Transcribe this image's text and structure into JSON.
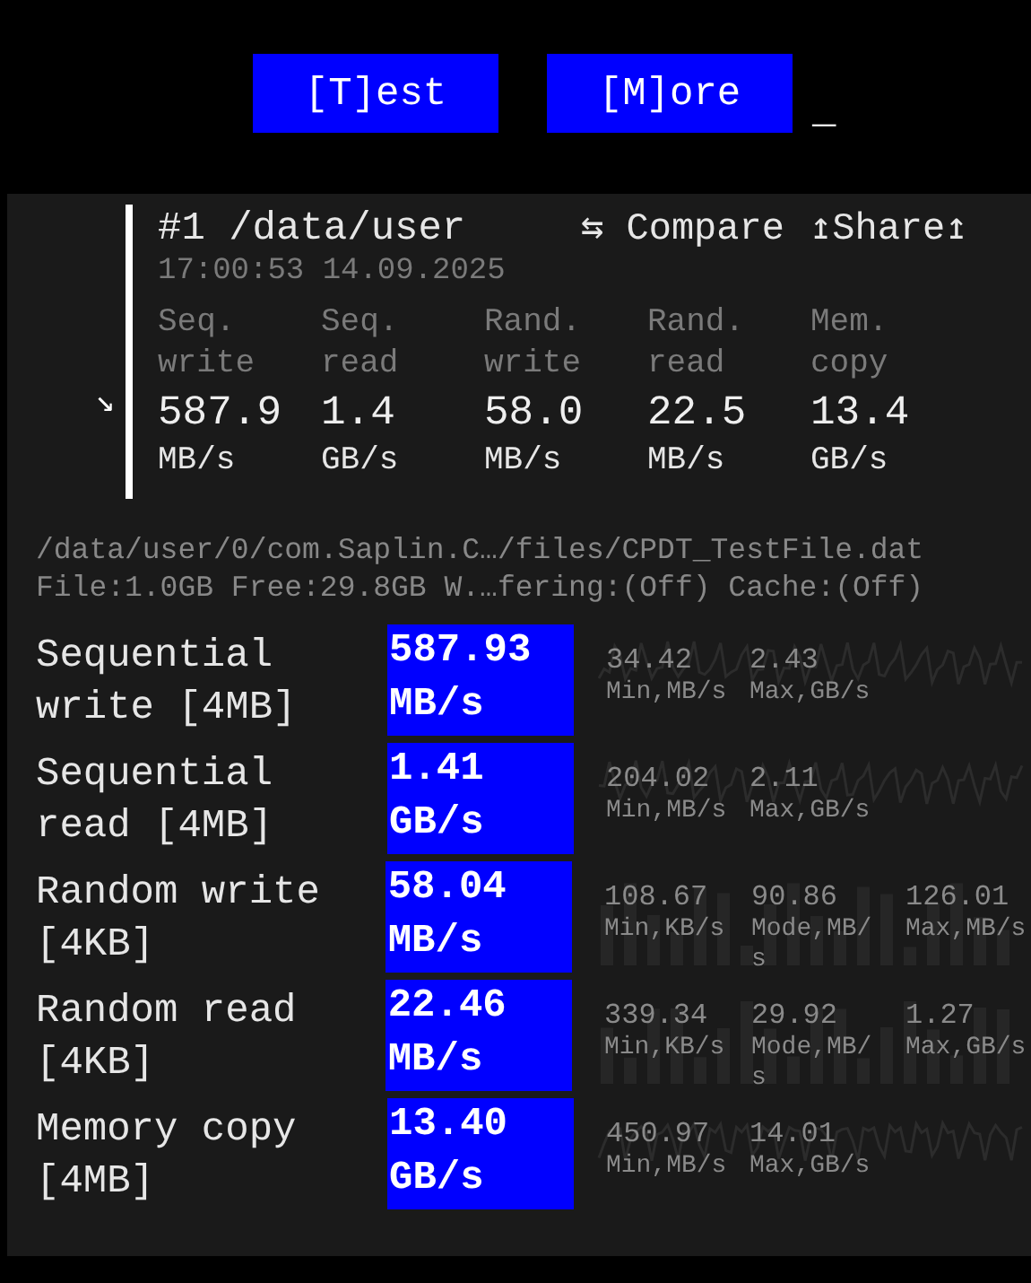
{
  "top_buttons": [
    "[T]est",
    "[M]ore"
  ],
  "cursor": "_",
  "result": {
    "expand_arrow": "↘",
    "title": "#1 /data/user",
    "compare": "⇆ Compare",
    "share": "↥Share↥",
    "timestamp": "17:00:53 14.09.2025",
    "summary": [
      {
        "label": "Seq. write",
        "value": "587.9",
        "unit": "MB/s"
      },
      {
        "label": "Seq. read",
        "value": "1.4",
        "unit": "GB/s"
      },
      {
        "label": "Rand. write",
        "value": "58.0",
        "unit": "MB/s"
      },
      {
        "label": "Rand. read",
        "value": "22.5",
        "unit": "MB/s"
      },
      {
        "label": "Mem. copy",
        "value": "13.4",
        "unit": "GB/s"
      }
    ]
  },
  "file_path": "/data/user/0/com.Saplin.C…/files/CPDT_TestFile.dat",
  "file_info": "File:1.0GB Free:29.8GB W.…fering:(Off) Cache:(Off)",
  "tests": [
    {
      "name": "Sequential write [4MB]",
      "value": "587.93",
      "unit": "MB/s",
      "kind": "line",
      "stats": [
        {
          "value": "34.42",
          "label": "Min,MB/s"
        },
        {
          "value": "2.43",
          "label": "Max,GB/s"
        }
      ]
    },
    {
      "name": "Sequential read [4MB]",
      "value": "1.41",
      "unit": "GB/s",
      "kind": "line",
      "stats": [
        {
          "value": "204.02",
          "label": "Min,MB/s"
        },
        {
          "value": "2.11",
          "label": "Max,GB/s"
        }
      ]
    },
    {
      "name": "Random write [4KB]",
      "value": "58.04",
      "unit": "MB/s",
      "kind": "bars",
      "stats": [
        {
          "value": "108.67",
          "label": "Min,KB/s"
        },
        {
          "value": "90.86",
          "label": "Mode,MB/s"
        },
        {
          "value": "126.01",
          "label": "Max,MB/s"
        }
      ]
    },
    {
      "name": "Random read [4KB]",
      "value": "22.46",
      "unit": "MB/s",
      "kind": "bars",
      "stats": [
        {
          "value": "339.34",
          "label": "Min,KB/s"
        },
        {
          "value": "29.92",
          "label": "Mode,MB/s"
        },
        {
          "value": "1.27",
          "label": "Max,GB/s"
        }
      ]
    },
    {
      "name": "Memory copy [4MB]",
      "value": "13.40",
      "unit": "GB/s",
      "kind": "line",
      "stats": [
        {
          "value": "450.97",
          "label": "Min,MB/s"
        },
        {
          "value": "14.01",
          "label": "Max,GB/s"
        }
      ]
    }
  ]
}
